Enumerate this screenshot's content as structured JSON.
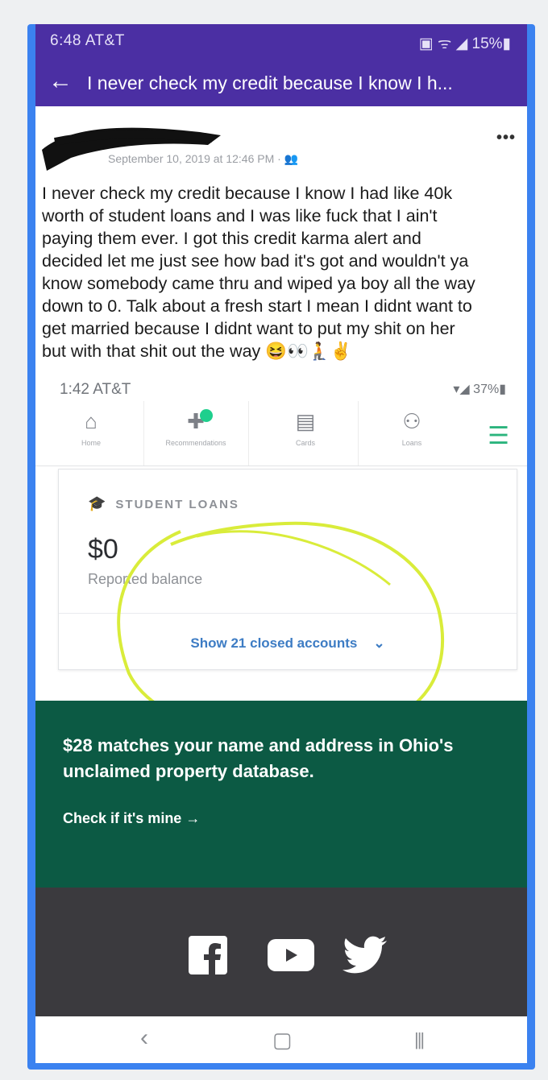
{
  "status_bar": {
    "time": "6:48 AT&T",
    "icons": "▣ ᯤ ◢ 15%▮"
  },
  "title_bar": {
    "back_icon": "arrow-left-icon",
    "title": "I never check my credit because I know I h..."
  },
  "post": {
    "date": "September 10, 2019 at 12:46 PM · ",
    "more": "•••",
    "lines": [
      "I never check my credit because I know I had like 40k",
      "worth of student loans and I was like fuck that I ain't",
      "paying them ever. I got this credit karma alert and",
      "decided let me just see how bad it's got and wouldn't ya",
      "know somebody came thru and wiped ya boy all the way",
      "down to 0. Talk about a fresh start I mean I didnt want to",
      "get married because I didnt want to put my shit on her",
      "but with that shit out the way"
    ]
  },
  "screenshot": {
    "status_time": "1:42 AT&T",
    "status_right": "▾◢ 37%▮",
    "nav": [
      {
        "icon": "home-icon",
        "label": "Home"
      },
      {
        "icon": "recommendations-icon",
        "label": "Recommendations"
      },
      {
        "icon": "cards-icon",
        "label": "Cards"
      },
      {
        "icon": "loans-icon",
        "label": "Loans"
      }
    ],
    "loans": {
      "title": "STUDENT LOANS",
      "amount": "$0",
      "sub": "Reported balance",
      "link": "Show 21 closed accounts"
    },
    "promo": {
      "text": "$28 matches your name and address in Ohio's unclaimed property database.",
      "link": "Check if it's mine →"
    }
  },
  "colors": {
    "header": "#4b2fa3",
    "promo": "#0c5a44",
    "footer": "#3b3a3e",
    "highlight": "#d9ec3a"
  }
}
